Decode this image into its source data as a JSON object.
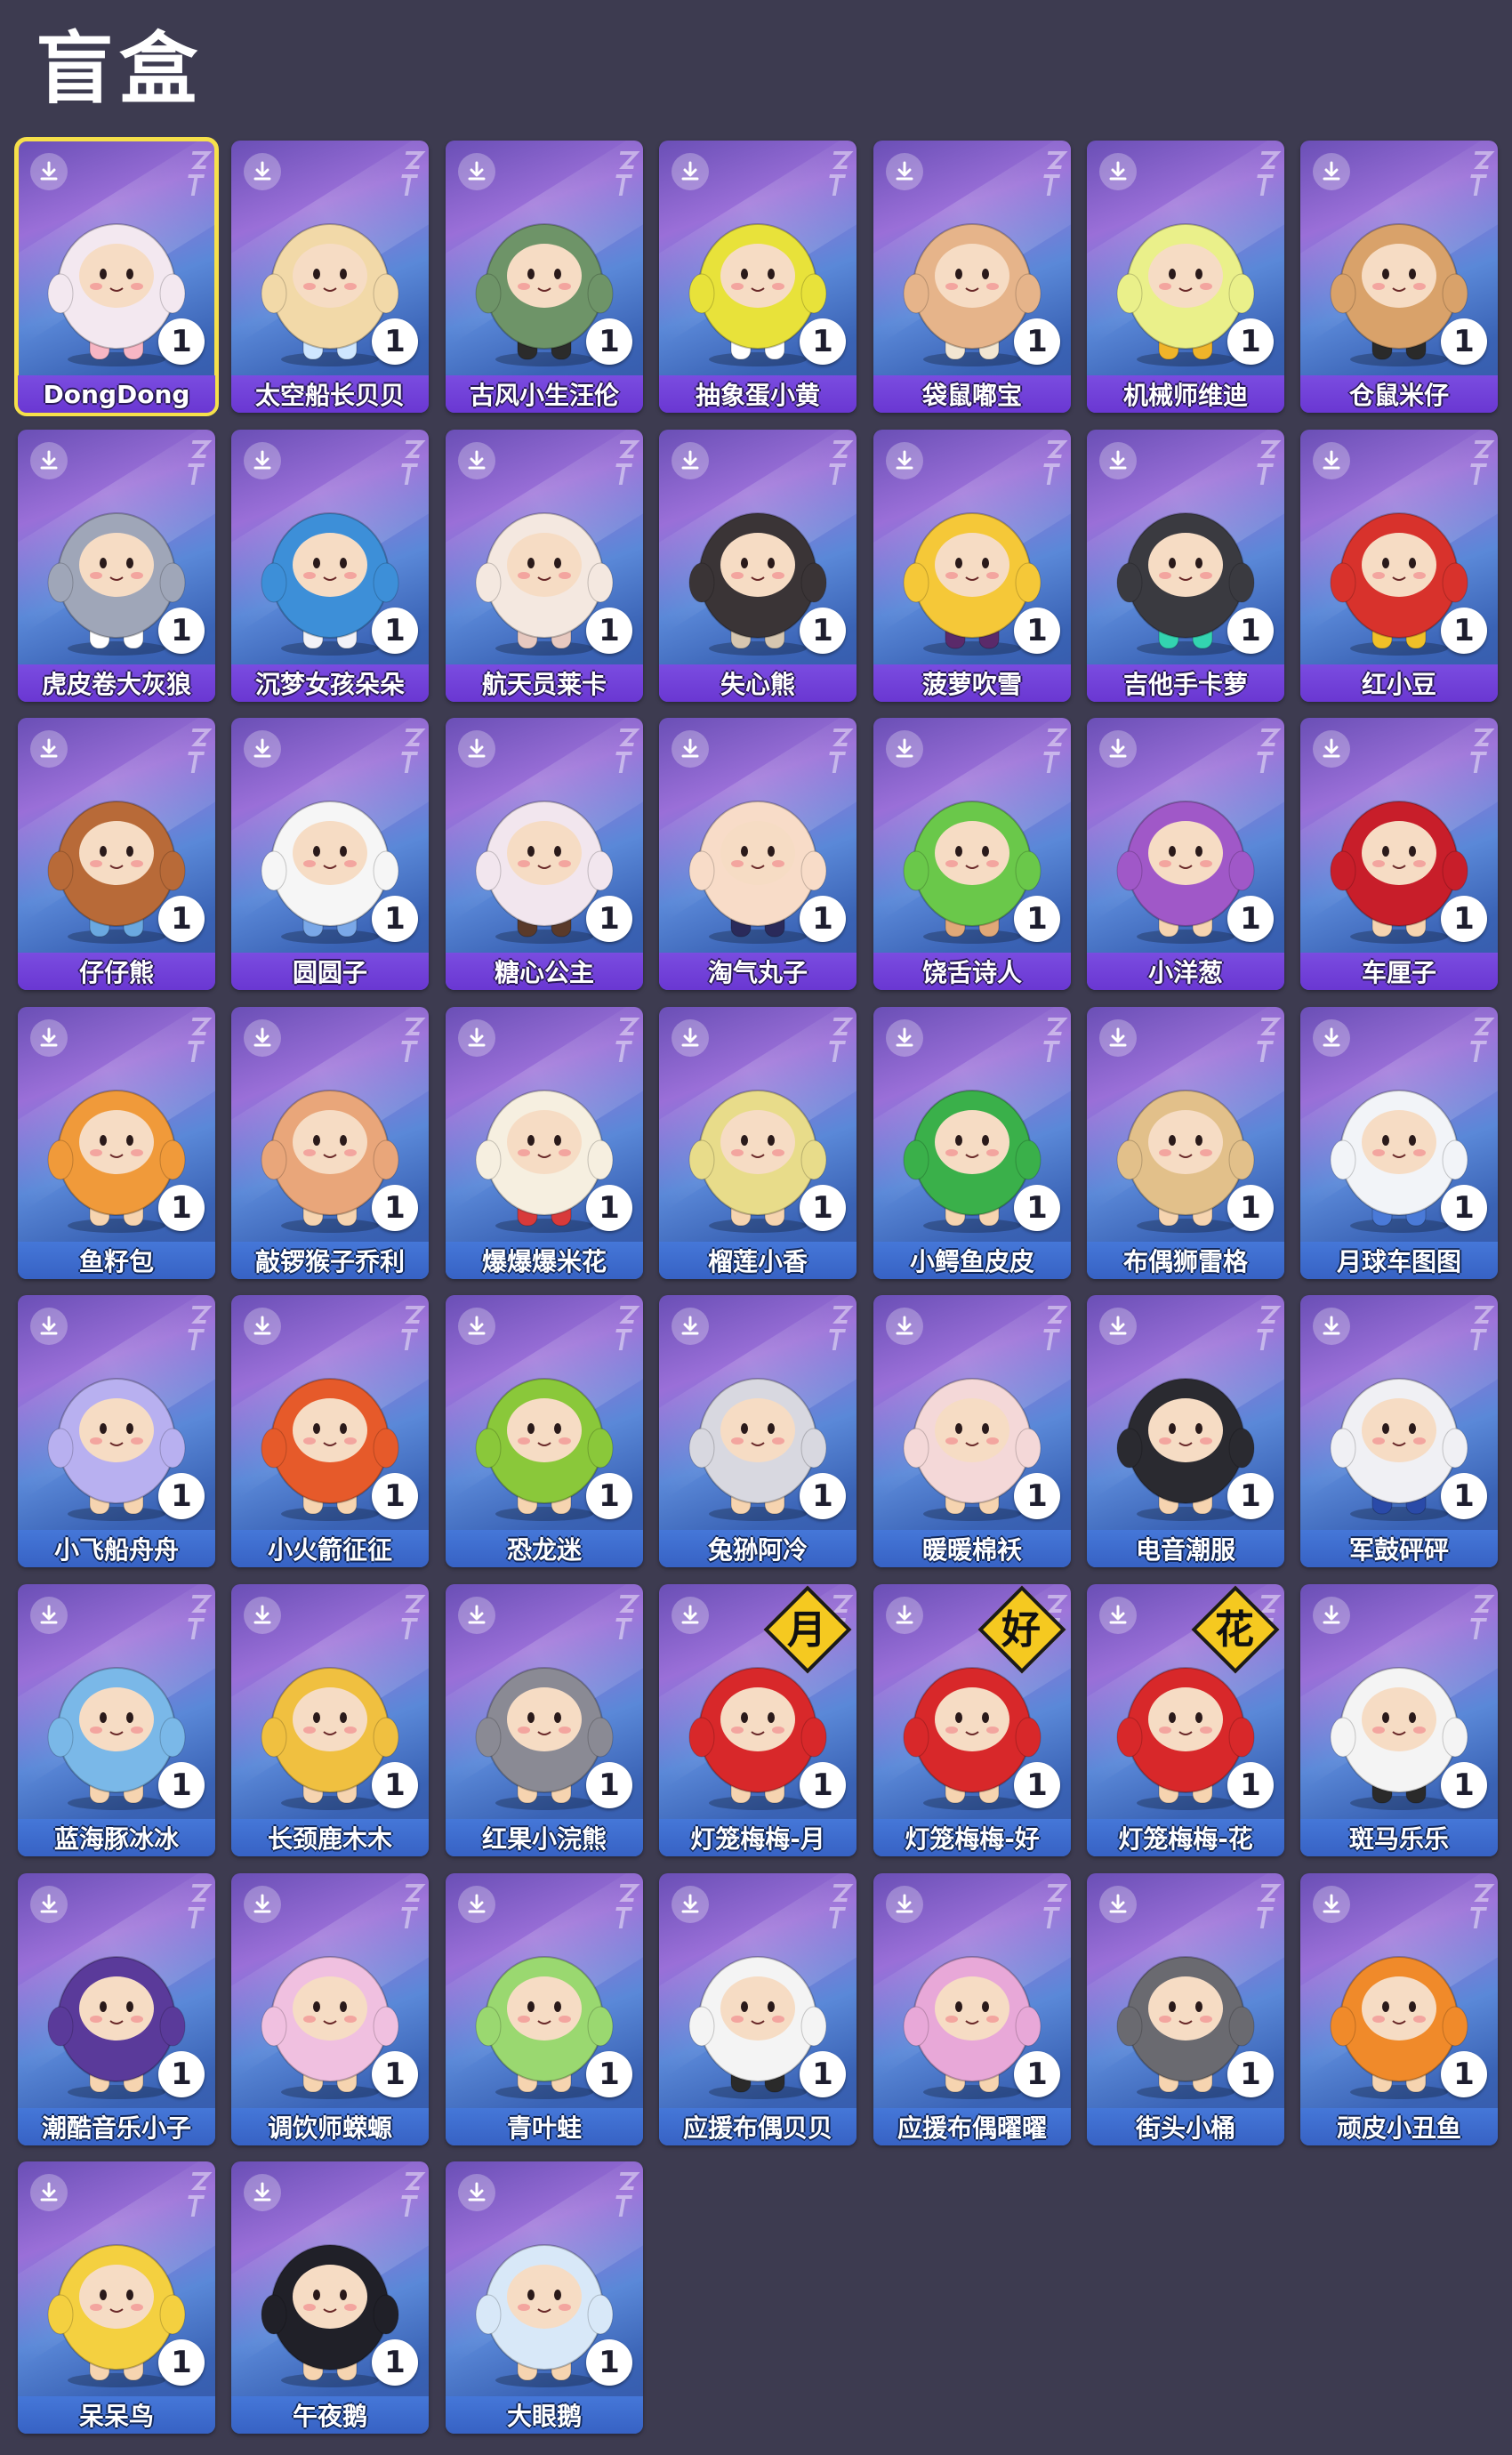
{
  "title": "盲盒",
  "icons": {
    "download": "download-icon",
    "brand": "brand-logo",
    "count": "count-badge"
  },
  "colors": {
    "background": "#3d3b50",
    "selected_outline": "#f6e04a",
    "nameplate_purple": "#6a37d2",
    "nameplate_blue": "#3762c4"
  },
  "items": [
    {
      "name": "DongDong",
      "count": "1",
      "body": "#f3e8f0",
      "accent": "#f7b6c4",
      "plate": "purple",
      "selected": true
    },
    {
      "name": "太空船长贝贝",
      "count": "1",
      "body": "#f2d9a8",
      "accent": "#cfe7ff",
      "plate": "purple"
    },
    {
      "name": "古风小生汪伦",
      "count": "1",
      "body": "#6e9468",
      "accent": "#2b2b2b",
      "plate": "purple"
    },
    {
      "name": "抽象蛋小黄",
      "count": "1",
      "body": "#e8e23a",
      "accent": "#ffffff",
      "plate": "purple"
    },
    {
      "name": "袋鼠嘟宝",
      "count": "1",
      "body": "#e6b48a",
      "accent": "#f2e6d2",
      "plate": "purple"
    },
    {
      "name": "机械师维迪",
      "count": "1",
      "body": "#eaf08a",
      "accent": "#f0b42a",
      "plate": "purple"
    },
    {
      "name": "仓鼠米仔",
      "count": "1",
      "body": "#d9a26a",
      "accent": "#2a2a2a",
      "plate": "purple"
    },
    {
      "name": "虎皮卷大灰狼",
      "count": "1",
      "body": "#9fa6b8",
      "accent": "#ffffff",
      "plate": "purple"
    },
    {
      "name": "沉梦女孩朵朵",
      "count": "1",
      "body": "#3d8fd8",
      "accent": "#f2f2f8",
      "plate": "purple"
    },
    {
      "name": "航天员莱卡",
      "count": "1",
      "body": "#f4e8e0",
      "accent": "#e7c9c0",
      "plate": "purple"
    },
    {
      "name": "失心熊",
      "count": "1",
      "body": "#3a3436",
      "accent": "#d6c6b0",
      "plate": "purple"
    },
    {
      "name": "菠萝吹雪",
      "count": "1",
      "body": "#f5c838",
      "accent": "#5a2a6a",
      "plate": "purple"
    },
    {
      "name": "吉他手卡萝",
      "count": "1",
      "body": "#3a3a40",
      "accent": "#33d4b0",
      "plate": "purple"
    },
    {
      "name": "红小豆",
      "count": "1",
      "body": "#d8322c",
      "accent": "#f0c028",
      "plate": "purple"
    },
    {
      "name": "仔仔熊",
      "count": "1",
      "body": "#b86a38",
      "accent": "#6aa8e0",
      "plate": "purple"
    },
    {
      "name": "圆圆子",
      "count": "1",
      "body": "#f6f6f6",
      "accent": "#7aa8e8",
      "plate": "purple"
    },
    {
      "name": "糖心公主",
      "count": "1",
      "body": "#f2e6ee",
      "accent": "#5a3a2a",
      "plate": "purple"
    },
    {
      "name": "淘气丸子",
      "count": "1",
      "body": "#f8dcc8",
      "accent": "#2a2a5a",
      "plate": "purple"
    },
    {
      "name": "饶舌诗人",
      "count": "1",
      "body": "#6ac84a",
      "accent": "#e0a878",
      "plate": "purple"
    },
    {
      "name": "小洋葱",
      "count": "1",
      "body": "#a058c8",
      "accent": "#f6d4b0",
      "plate": "purple"
    },
    {
      "name": "车厘子",
      "count": "1",
      "body": "#c81e2a",
      "accent": "#f6d4b0",
      "plate": "purple"
    },
    {
      "name": "鱼籽包",
      "count": "1",
      "body": "#f09a3a",
      "accent": "#f6d4b0",
      "plate": "blue"
    },
    {
      "name": "敲锣猴子乔利",
      "count": "1",
      "body": "#e9a67a",
      "accent": "#f6d4b0",
      "plate": "blue"
    },
    {
      "name": "爆爆爆米花",
      "count": "1",
      "body": "#f6efe0",
      "accent": "#d83a3a",
      "plate": "blue"
    },
    {
      "name": "榴莲小香",
      "count": "1",
      "body": "#e8dc8a",
      "accent": "#f6d4b0",
      "plate": "blue"
    },
    {
      "name": "小鳄鱼皮皮",
      "count": "1",
      "body": "#3ab04a",
      "accent": "#f6d4b0",
      "plate": "blue"
    },
    {
      "name": "布偶狮雷格",
      "count": "1",
      "body": "#e2c08a",
      "accent": "#f6d4b0",
      "plate": "blue"
    },
    {
      "name": "月球车图图",
      "count": "1",
      "body": "#f2f4f8",
      "accent": "#4a7ad8",
      "plate": "blue"
    },
    {
      "name": "小飞船舟舟",
      "count": "1",
      "body": "#b8b0f0",
      "accent": "#f6d4b0",
      "plate": "blue"
    },
    {
      "name": "小火箭征征",
      "count": "1",
      "body": "#e65a2a",
      "accent": "#f6d4b0",
      "plate": "blue"
    },
    {
      "name": "恐龙迷",
      "count": "1",
      "body": "#8ac83a",
      "accent": "#f6d4b0",
      "plate": "blue"
    },
    {
      "name": "兔狲阿冷",
      "count": "1",
      "body": "#d8d8e0",
      "accent": "#f6d4b0",
      "plate": "blue"
    },
    {
      "name": "暖暖棉袄",
      "count": "1",
      "body": "#f4d8d8",
      "accent": "#f6d4b0",
      "plate": "blue"
    },
    {
      "name": "电音潮服",
      "count": "1",
      "body": "#2a2a30",
      "accent": "#f6d4b0",
      "plate": "blue"
    },
    {
      "name": "军鼓砰砰",
      "count": "1",
      "body": "#f0f0f4",
      "accent": "#2a4aa8",
      "plate": "blue"
    },
    {
      "name": "蓝海豚冰冰",
      "count": "1",
      "body": "#7ab8e8",
      "accent": "#f6d4b0",
      "plate": "blue"
    },
    {
      "name": "长颈鹿木木",
      "count": "1",
      "body": "#f0c040",
      "accent": "#f6d4b0",
      "plate": "blue"
    },
    {
      "name": "红果小浣熊",
      "count": "1",
      "body": "#8a8a94",
      "accent": "#f6d4b0",
      "plate": "blue"
    },
    {
      "name": "灯笼梅梅-月",
      "count": "1",
      "body": "#d8282a",
      "accent": "#f6d4b0",
      "plate": "blue",
      "sign": "月"
    },
    {
      "name": "灯笼梅梅-好",
      "count": "1",
      "body": "#d8282a",
      "accent": "#f6d4b0",
      "plate": "blue",
      "sign": "好"
    },
    {
      "name": "灯笼梅梅-花",
      "count": "1",
      "body": "#d8282a",
      "accent": "#f6d4b0",
      "plate": "blue",
      "sign": "花"
    },
    {
      "name": "斑马乐乐",
      "count": "1",
      "body": "#f4f4f4",
      "accent": "#2a2a2a",
      "plate": "blue"
    },
    {
      "name": "潮酷音乐小子",
      "count": "1",
      "body": "#5a3a9a",
      "accent": "#f6d4b0",
      "plate": "blue"
    },
    {
      "name": "调饮师蝾螈",
      "count": "1",
      "body": "#f0c0e0",
      "accent": "#f6d4b0",
      "plate": "blue"
    },
    {
      "name": "青叶蛙",
      "count": "1",
      "body": "#9ad870",
      "accent": "#f6d4b0",
      "plate": "blue"
    },
    {
      "name": "应援布偶贝贝",
      "count": "1",
      "body": "#f4f4f4",
      "accent": "#2a2a2a",
      "plate": "blue"
    },
    {
      "name": "应援布偶曜曜",
      "count": "1",
      "body": "#e8a8d8",
      "accent": "#f6d4b0",
      "plate": "blue"
    },
    {
      "name": "街头小桶",
      "count": "1",
      "body": "#6a6a70",
      "accent": "#f6d4b0",
      "plate": "blue"
    },
    {
      "name": "顽皮小丑鱼",
      "count": "1",
      "body": "#f08a2a",
      "accent": "#f6d4b0",
      "plate": "blue"
    },
    {
      "name": "呆呆鸟",
      "count": "1",
      "body": "#f4d040",
      "accent": "#f6d4b0",
      "plate": "blue"
    },
    {
      "name": "午夜鹅",
      "count": "1",
      "body": "#202028",
      "accent": "#f6d4b0",
      "plate": "blue"
    },
    {
      "name": "大眼鹅",
      "count": "1",
      "body": "#d8e8f8",
      "accent": "#f6d4b0",
      "plate": "blue"
    }
  ]
}
